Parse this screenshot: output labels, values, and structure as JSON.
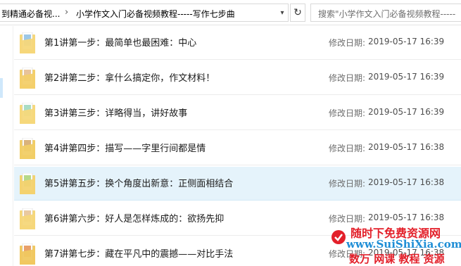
{
  "address_bar": {
    "crumbs": [
      "到精通必备视...",
      "小学作文入门必备视频教程-----写作七步曲"
    ],
    "search_placeholder": "搜索\"小学作文入门必备视频教程-----"
  },
  "modified_label": "修改日期:",
  "files": [
    {
      "name": "第1讲第一步：最简单也最困难：中心",
      "modified": "2019-05-17 16:39",
      "selected": false
    },
    {
      "name": "第2讲第二步：拿什么搞定你，作文材料！",
      "modified": "2019-05-17 16:39",
      "selected": false
    },
    {
      "name": "第3讲第三步：详略得当，讲好故事",
      "modified": "2019-05-17 16:39",
      "selected": false
    },
    {
      "name": "第4讲第四步：描写——字里行间都是情",
      "modified": "2019-05-17 16:38",
      "selected": false
    },
    {
      "name": "第5讲第五步：换个角度出新意：正侧面相结合",
      "modified": "2019-05-17 16:38",
      "selected": true
    },
    {
      "name": "第6讲第六步：好人是怎样炼成的：欲扬先抑",
      "modified": "2019-05-17 16:38",
      "selected": false
    },
    {
      "name": "第7讲第七步：藏在平凡中的震撼——对比手法",
      "modified": "2019-05-17 16:38",
      "selected": false
    }
  ],
  "watermark": {
    "line1": "随时下免费资源网",
    "line2": "www.SuiShiXia.com",
    "line3": "数万 网课 教程 资源"
  },
  "colors": {
    "selected_row": "#e5f3fb",
    "watermark_red": "#e3202a",
    "watermark_blue": "#1f8ed6"
  }
}
